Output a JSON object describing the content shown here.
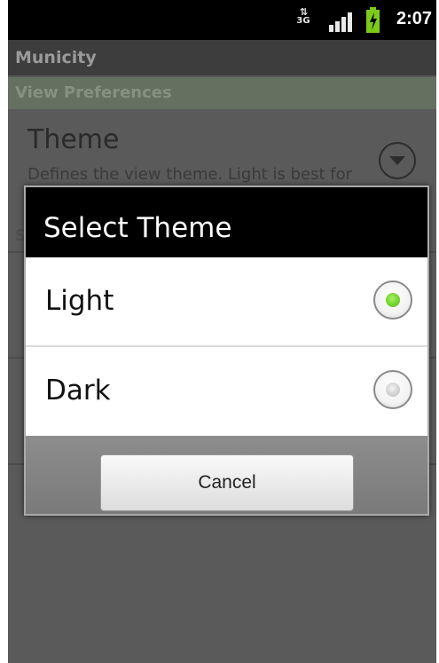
{
  "status_bar": {
    "network_label": "3G",
    "network_arrows": "⇅",
    "time": "2:07",
    "battery_color": "#7ccb1b"
  },
  "app": {
    "title": "Municity"
  },
  "preferences": {
    "category_label": "View Preferences",
    "theme_pref": {
      "title": "Theme",
      "summary": "Defines the view theme. Light is best for outdoor usage, Dark for indoor."
    },
    "second_category_letter": "S"
  },
  "dialog": {
    "title": "Select Theme",
    "options": [
      {
        "label": "Light",
        "selected": true
      },
      {
        "label": "Dark",
        "selected": false
      }
    ],
    "cancel_label": "Cancel"
  },
  "colors": {
    "radio_selected": "#6fd12a",
    "radio_unselected": "#c9c9c9"
  }
}
